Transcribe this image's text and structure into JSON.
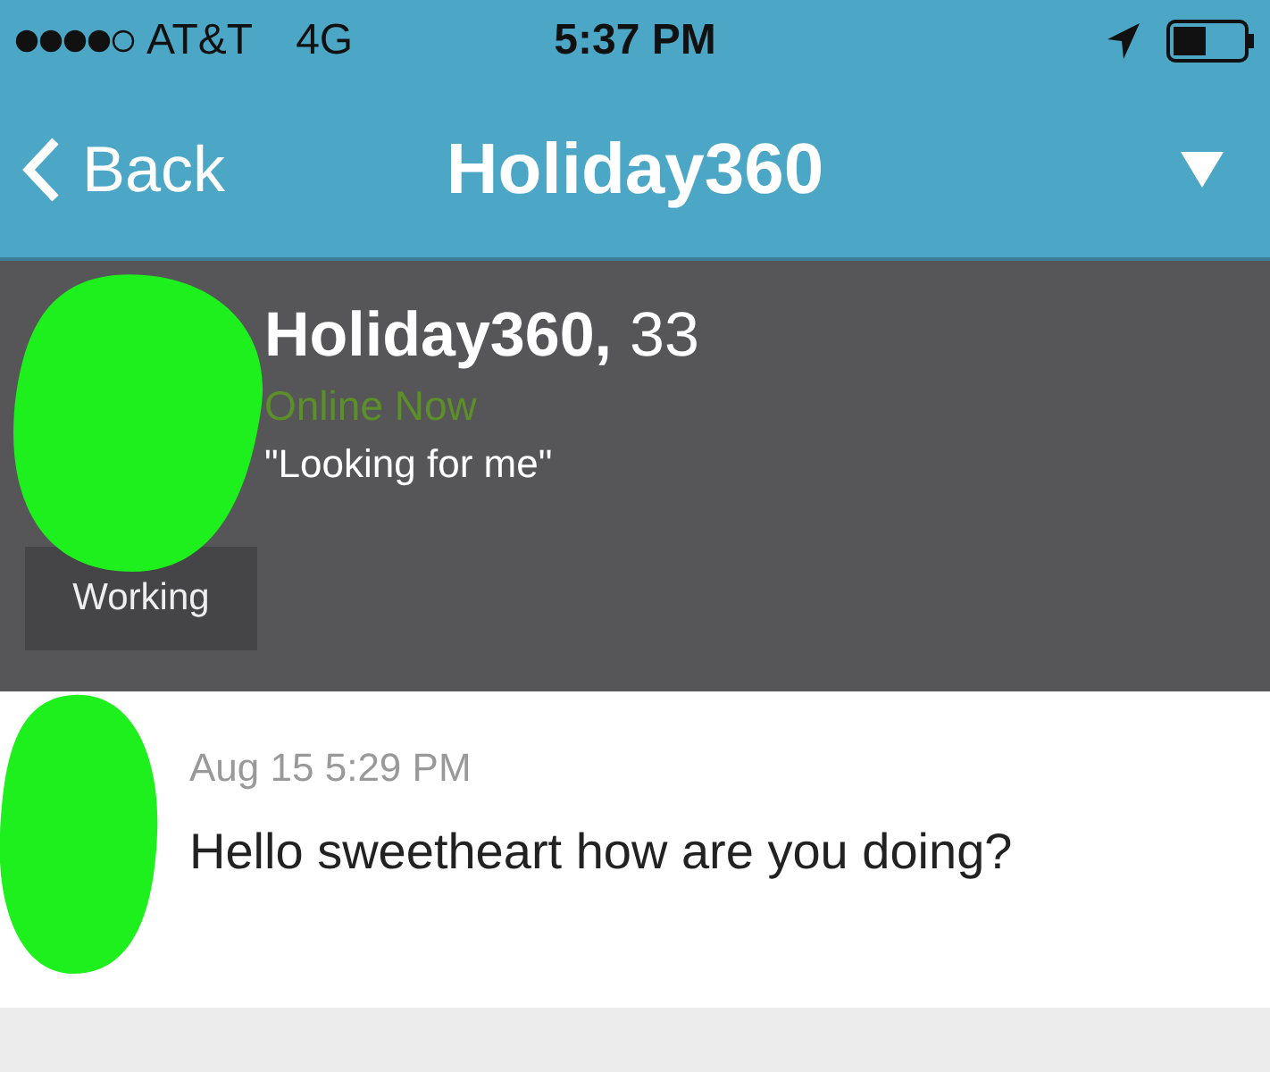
{
  "status_bar": {
    "carrier": "AT&T",
    "network": "4G",
    "time": "5:37 PM"
  },
  "nav_bar": {
    "back": "Back",
    "title": "Holiday360"
  },
  "profile": {
    "name": "Holiday360,",
    "age": "33",
    "status": "Online Now",
    "tagline": "\"Looking for me\"",
    "tag": "Working"
  },
  "messages": [
    {
      "time": "Aug 15 5:29 PM",
      "text": "Hello sweetheart how are you doing?"
    }
  ]
}
